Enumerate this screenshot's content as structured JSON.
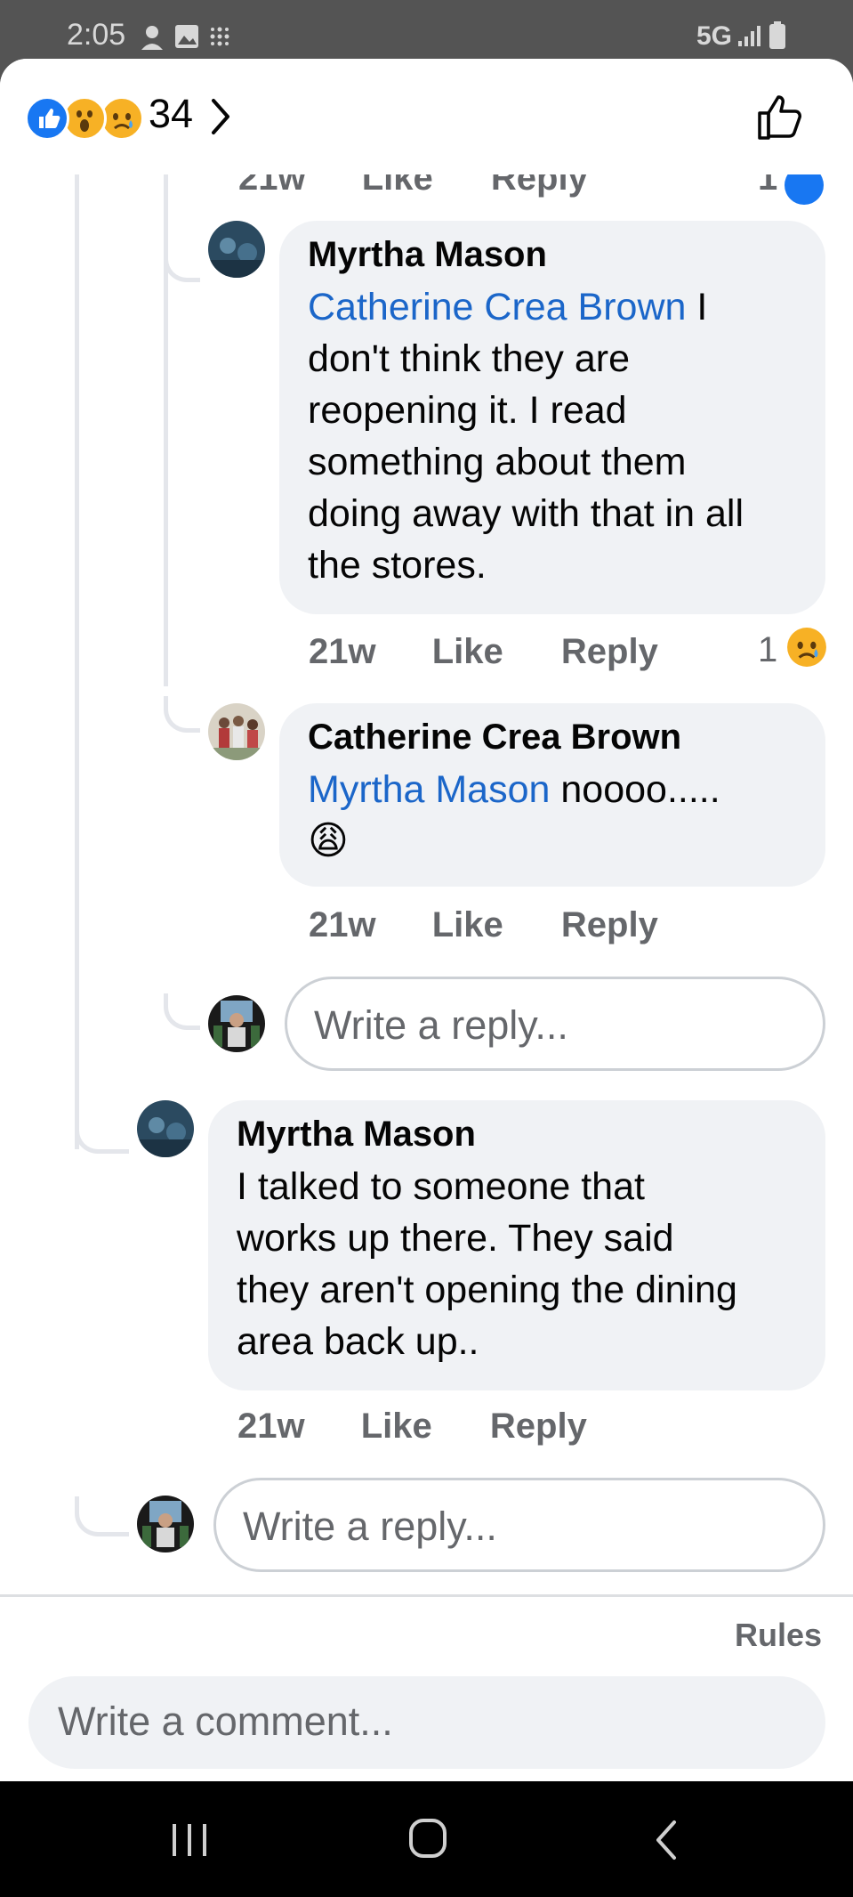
{
  "status_bar": {
    "time": "2:05",
    "network": "5G"
  },
  "header": {
    "reactions": [
      "like-reaction",
      "wow-reaction",
      "sad-reaction"
    ],
    "reaction_count": "34",
    "like_button_icon": "thumbs-up-icon"
  },
  "top_partial": {
    "time": "21w",
    "like": "Like",
    "reply": "Reply",
    "count": "1"
  },
  "comments": [
    {
      "author": "Myrtha Mason",
      "mention": "Catherine Crea Brown",
      "lines": [
        " I",
        "don't think they are",
        "reopening it.  I read",
        "something about them",
        "doing away with that in all",
        "the stores."
      ],
      "time": "21w",
      "like": "Like",
      "reply": "Reply",
      "reaction_count": "1",
      "reaction_icon": "sad-reaction"
    },
    {
      "author": "Catherine Crea Brown",
      "mention": "Myrtha Mason",
      "text": " noooo.....",
      "emoji": "😩",
      "time": "21w",
      "like": "Like",
      "reply": "Reply"
    },
    {
      "author": "Myrtha Mason",
      "lines": [
        "I talked to someone that",
        "works up there.  They said",
        "they aren't opening the dining",
        "area back up.."
      ],
      "time": "21w",
      "like": "Like",
      "reply": "Reply"
    }
  ],
  "reply_placeholder": "Write a reply...",
  "footer": {
    "rules": "Rules",
    "comment_placeholder": "Write a comment..."
  }
}
